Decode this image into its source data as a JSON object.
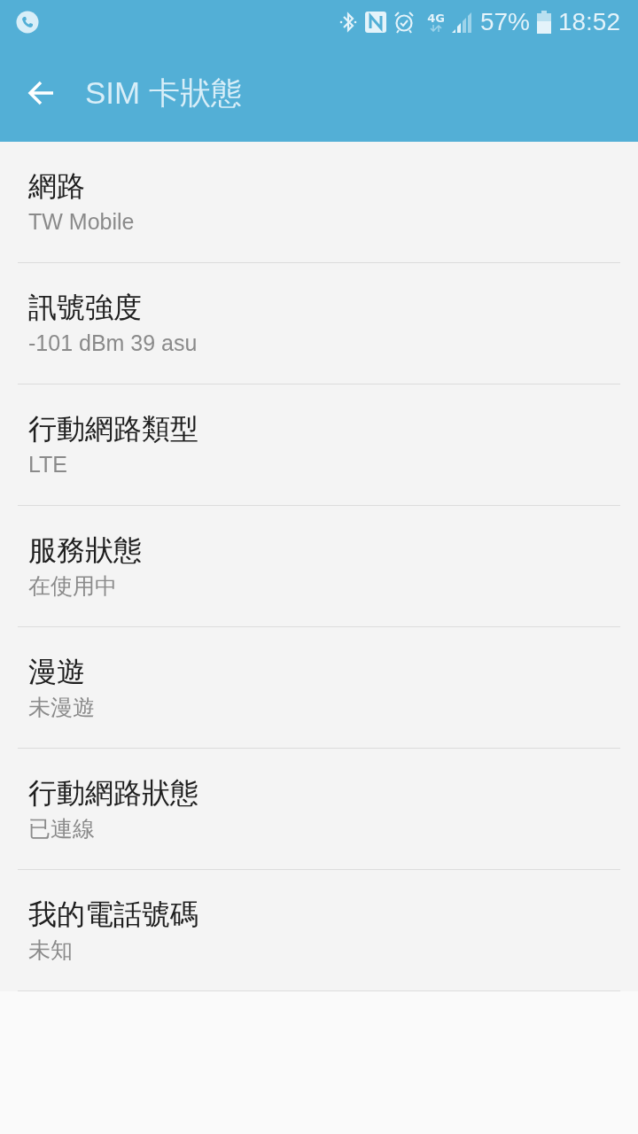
{
  "status_bar": {
    "network_type": "4G",
    "battery": "57%",
    "time": "18:52"
  },
  "app_bar": {
    "title": "SIM 卡狀態"
  },
  "items": [
    {
      "title": "網路",
      "value": "TW Mobile"
    },
    {
      "title": "訊號強度",
      "value": "-101 dBm 39 asu"
    },
    {
      "title": "行動網路類型",
      "value": "LTE"
    },
    {
      "title": "服務狀態",
      "value": "在使用中"
    },
    {
      "title": "漫遊",
      "value": "未漫遊"
    },
    {
      "title": "行動網路狀態",
      "value": "已連線"
    },
    {
      "title": "我的電話號碼",
      "value": "未知"
    }
  ]
}
